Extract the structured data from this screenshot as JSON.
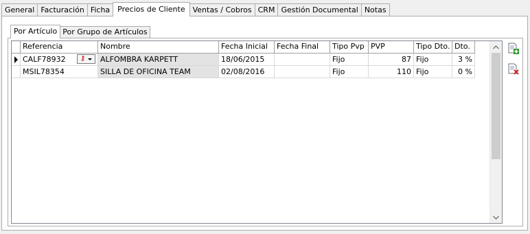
{
  "outer_tabs": [
    {
      "label": "General"
    },
    {
      "label": "Facturación"
    },
    {
      "label": "Ficha"
    },
    {
      "label": "Precios de Cliente"
    },
    {
      "label": "Ventas / Cobros"
    },
    {
      "label": "CRM"
    },
    {
      "label": "Gestión Documental"
    },
    {
      "label": "Notas"
    }
  ],
  "outer_active_tab": "Precios de Cliente",
  "inner_tabs": [
    {
      "label": "Por Artículo"
    },
    {
      "label": "Por Grupo de Artículos"
    }
  ],
  "inner_active_tab": "Por Artículo",
  "grid": {
    "columns": [
      "Referencia",
      "Nombre",
      "Fecha Inicial",
      "Fecha Final",
      "Tipo Pvp",
      "PVP",
      "Tipo Dto.",
      "Dto."
    ],
    "rows": [
      {
        "referencia": "CALF78932",
        "nombre": "ALFOMBRA KARPETT",
        "fecha_inicial": "18/06/2015",
        "fecha_final": "",
        "tipo_pvp": "Fijo",
        "pvp": "87",
        "tipo_dto": "Fijo",
        "dto": "3 %",
        "current": true
      },
      {
        "referencia": "MSIL78354",
        "nombre": "SILLA DE OFICINA TEAM",
        "fecha_inicial": "02/08/2016",
        "fecha_final": "",
        "tipo_pvp": "Fijo",
        "pvp": "110",
        "tipo_dto": "Fijo",
        "dto": "0 %",
        "current": false
      }
    ]
  },
  "icons": {
    "row_indicator": "current-row-arrow-icon",
    "lookup": "key-lookup-icon",
    "add": "add-document-icon",
    "delete": "delete-document-icon"
  },
  "colors": {
    "selected_tab_bg": "#ffffff",
    "readonly_cell_bg": "#e3e3e3",
    "add_accent": "#2e9e2e",
    "delete_accent": "#d22020",
    "lookup_accent": "#c00000"
  }
}
